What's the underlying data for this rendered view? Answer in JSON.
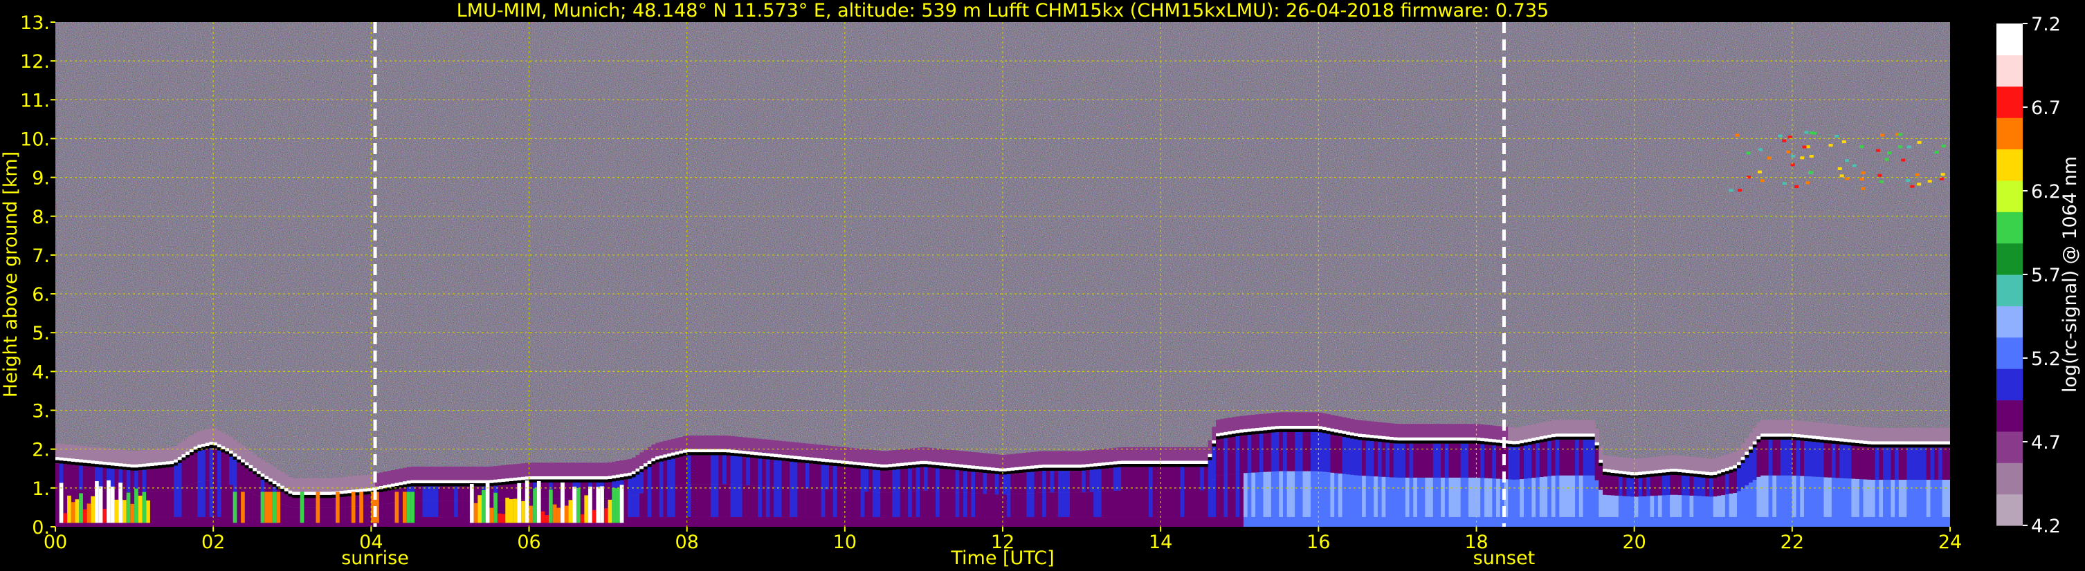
{
  "chart_data": {
    "type": "heatmap",
    "title": "LMU-MIM, Munich; 48.148° N 11.573° E, altitude: 539 m    Lufft CHM15kx (CHM15kxLMU): 26-04-2018    firmware: 0.735",
    "xlabel": "Time [UTC]",
    "ylabel": "Height above ground [km]",
    "colorbar_label": "log(rc-signal) @ 1064 nm",
    "xlim": [
      0,
      24
    ],
    "ylim": [
      0,
      13
    ],
    "x_ticks": [
      "00",
      "02",
      "04",
      "06",
      "08",
      "10",
      "12",
      "14",
      "16",
      "18",
      "20",
      "22",
      "24"
    ],
    "y_ticks": [
      "0.",
      "1.",
      "2.",
      "3.",
      "4.",
      "5.",
      "6.",
      "7.",
      "8.",
      "9.",
      "10.",
      "11.",
      "12.",
      "13."
    ],
    "colorbar_range": [
      4.2,
      7.2
    ],
    "colorbar_ticks": [
      "4.2",
      "4.7",
      "5.2",
      "5.7",
      "6.2",
      "6.7",
      "7.2"
    ],
    "grid": true,
    "events": [
      {
        "label": "sunrise",
        "time": 4.05
      },
      {
        "label": "sunset",
        "time": 18.35
      }
    ],
    "boundary_layer_top_km": [
      [
        0.0,
        1.8
      ],
      [
        0.5,
        1.7
      ],
      [
        1.0,
        1.6
      ],
      [
        1.5,
        1.7
      ],
      [
        1.8,
        2.1
      ],
      [
        2.0,
        2.2
      ],
      [
        2.2,
        2.0
      ],
      [
        2.6,
        1.4
      ],
      [
        3.0,
        0.9
      ],
      [
        3.5,
        0.9
      ],
      [
        4.0,
        1.0
      ],
      [
        4.5,
        1.2
      ],
      [
        5.0,
        1.2
      ],
      [
        5.5,
        1.2
      ],
      [
        6.0,
        1.3
      ],
      [
        6.5,
        1.3
      ],
      [
        7.0,
        1.3
      ],
      [
        7.3,
        1.4
      ],
      [
        7.6,
        1.8
      ],
      [
        8.0,
        2.0
      ],
      [
        8.5,
        2.0
      ],
      [
        9.0,
        1.9
      ],
      [
        9.5,
        1.8
      ],
      [
        10.0,
        1.7
      ],
      [
        10.5,
        1.6
      ],
      [
        11.0,
        1.7
      ],
      [
        11.5,
        1.6
      ],
      [
        12.0,
        1.5
      ],
      [
        12.5,
        1.6
      ],
      [
        13.0,
        1.6
      ],
      [
        13.5,
        1.7
      ],
      [
        14.0,
        1.7
      ],
      [
        14.6,
        1.7
      ],
      [
        14.7,
        2.4
      ],
      [
        15.0,
        2.5
      ],
      [
        15.5,
        2.6
      ],
      [
        16.0,
        2.6
      ],
      [
        16.5,
        2.4
      ],
      [
        17.0,
        2.3
      ],
      [
        17.5,
        2.3
      ],
      [
        18.0,
        2.3
      ],
      [
        18.5,
        2.2
      ],
      [
        19.0,
        2.4
      ],
      [
        19.5,
        2.4
      ],
      [
        19.6,
        1.5
      ],
      [
        20.0,
        1.4
      ],
      [
        20.5,
        1.5
      ],
      [
        21.0,
        1.4
      ],
      [
        21.3,
        1.6
      ],
      [
        21.6,
        2.4
      ],
      [
        22.0,
        2.4
      ],
      [
        22.5,
        2.3
      ],
      [
        23.0,
        2.2
      ],
      [
        23.5,
        2.2
      ],
      [
        24.0,
        2.2
      ]
    ],
    "elevated_layer": {
      "time_range": [
        21.2,
        24.0
      ],
      "height_range_km": [
        8.7,
        10.2
      ]
    }
  },
  "colors": {
    "background": "#000000",
    "text": "#ffff00",
    "colorbar_text": "#ffffff",
    "grid": "#cccc00",
    "event_line": "#ffffff",
    "colormap": [
      "#b9a5b9",
      "#a07ca0",
      "#8a3a8a",
      "#6a006f",
      "#2a2ad8",
      "#4f74ff",
      "#8fb0ff",
      "#4ac2b2",
      "#13922a",
      "#39d24a",
      "#c8ff28",
      "#ffd900",
      "#ff7b00",
      "#ff1414",
      "#ffdada",
      "#ffffff"
    ]
  }
}
